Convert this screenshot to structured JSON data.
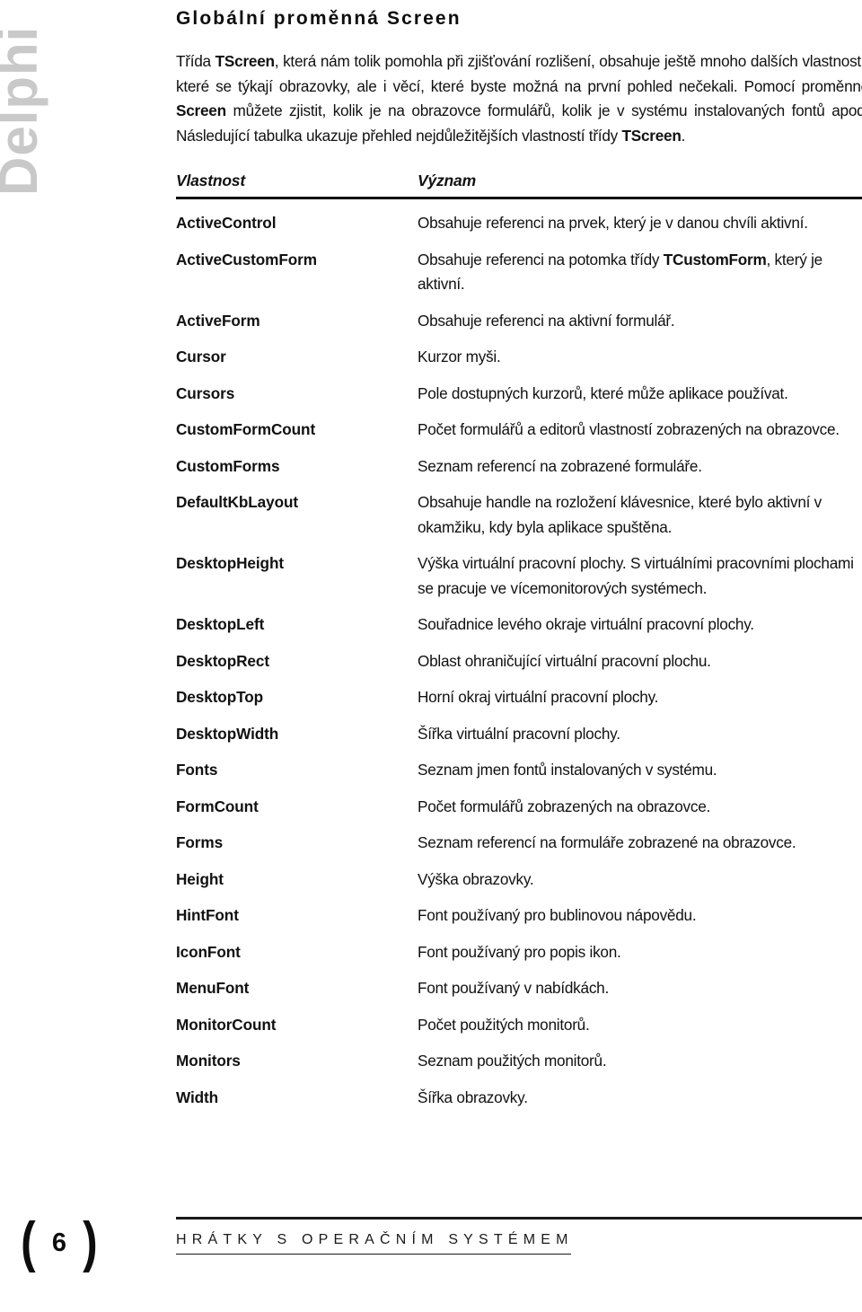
{
  "side_tab": {
    "label": "Delphi"
  },
  "page_title": "Globální proměnná Screen",
  "intro": {
    "part1": "Třída ",
    "bold1": "TScreen",
    "part2": ", která nám tolik pomohla při zjišťování rozlišení, obsahuje ještě mnoho dalších vlastností, které se týkají obrazovky, ale i věcí, které byste možná na první pohled nečekali. Pomocí proměnné ",
    "bold2": "Screen",
    "part3": " můžete zjistit, kolik je na obrazovce formulářů, kolik je v systému instalovaných fontů apod. Následující tabulka ukazuje přehled nejdůležitějších vlastností třídy ",
    "bold3": "TScreen",
    "part4": "."
  },
  "table": {
    "headers": {
      "property": "Vlastnost",
      "meaning": "Význam"
    },
    "rows": [
      {
        "name": "ActiveControl",
        "desc": "Obsahuje referenci na prvek, který je v danou chvíli aktivní."
      },
      {
        "name": "ActiveCustomForm",
        "desc_pre": "Obsahuje referenci na potomka třídy ",
        "desc_bold": "TCustomForm",
        "desc_post": ", který je aktivní."
      },
      {
        "name": "ActiveForm",
        "desc": "Obsahuje referenci na aktivní formulář."
      },
      {
        "name": "Cursor",
        "desc": "Kurzor myši."
      },
      {
        "name": "Cursors",
        "desc": "Pole dostupných kurzorů, které může aplikace používat."
      },
      {
        "name": "CustomFormCount",
        "desc": "Počet formulářů a editorů vlastností zobrazených na obrazovce."
      },
      {
        "name": "CustomForms",
        "desc": "Seznam referencí na zobrazené formuláře."
      },
      {
        "name": "DefaultKbLayout",
        "desc": "Obsahuje handle na rozložení klávesnice, které bylo aktivní v okamžiku, kdy byla aplikace spuštěna."
      },
      {
        "name": "DesktopHeight",
        "desc": "Výška virtuální pracovní plochy. S virtuálními pracovními plochami se pracuje ve vícemonitorových systémech."
      },
      {
        "name": "DesktopLeft",
        "desc": "Souřadnice levého okraje virtuální pracovní plochy."
      },
      {
        "name": "DesktopRect",
        "desc": "Oblast ohraničující virtuální pracovní plochu."
      },
      {
        "name": "DesktopTop",
        "desc": "Horní okraj virtuální pracovní plochy."
      },
      {
        "name": "DesktopWidth",
        "desc": "Šířka virtuální pracovní plochy."
      },
      {
        "name": "Fonts",
        "desc": "Seznam jmen fontů instalovaných v systému."
      },
      {
        "name": "FormCount",
        "desc": "Počet formulářů zobrazených na obrazovce."
      },
      {
        "name": "Forms",
        "desc": "Seznam referencí na formuláře zobrazené na obrazovce."
      },
      {
        "name": "Height",
        "desc": "Výška obrazovky."
      },
      {
        "name": "HintFont",
        "desc": "Font používaný pro bublinovou nápovědu."
      },
      {
        "name": "IconFont",
        "desc": "Font používaný pro popis ikon."
      },
      {
        "name": "MenuFont",
        "desc": "Font používaný v nabídkách."
      },
      {
        "name": "MonitorCount",
        "desc": "Počet použitých monitorů."
      },
      {
        "name": "Monitors",
        "desc": "Seznam použitých monitorů."
      },
      {
        "name": "Width",
        "desc": "Šířka obrazovky."
      }
    ]
  },
  "footer": {
    "paren_left": "(",
    "page_number": "6",
    "paren_right": ")",
    "chapter_title": "HRÁTKY S OPERAČNÍM SYSTÉMEM"
  },
  "colors": {
    "text": "#111111",
    "side_tab_gray": "#c9c9c9",
    "rule": "#1a1a1a"
  }
}
